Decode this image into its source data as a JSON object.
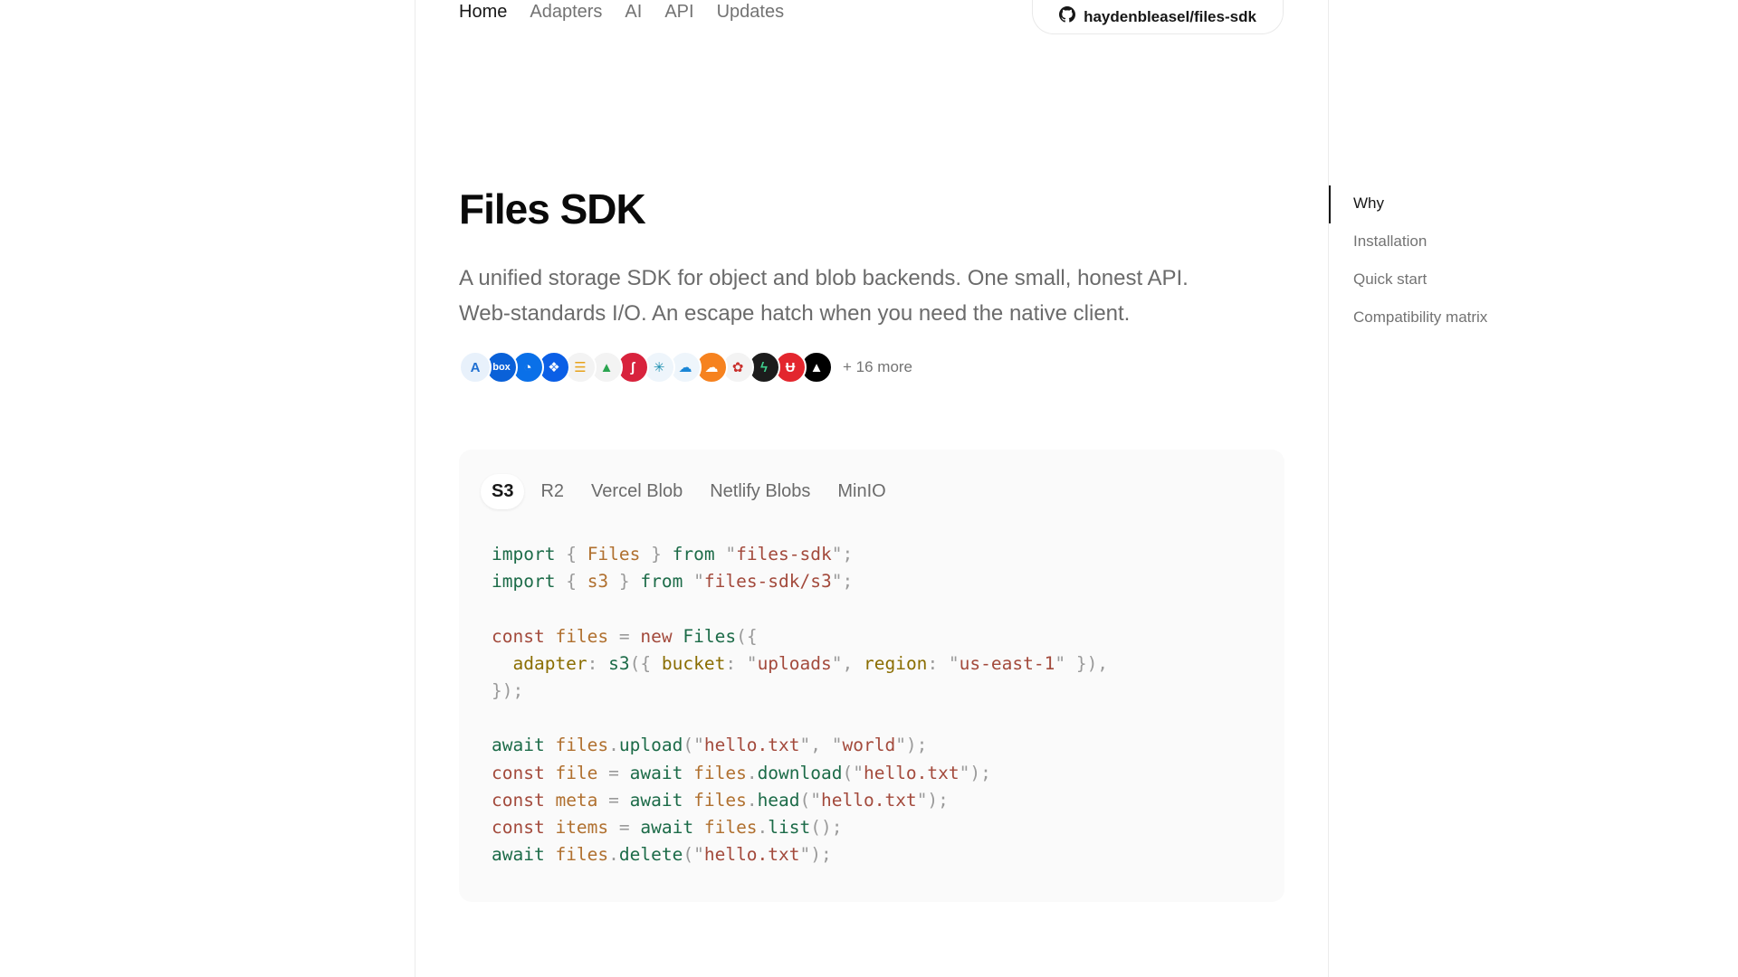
{
  "nav": {
    "links": [
      "Home",
      "Adapters",
      "AI",
      "API",
      "Updates"
    ],
    "repo_label": "haydenbleasel/files-sdk"
  },
  "hero": {
    "title": "Files SDK",
    "subtitle": "A unified storage SDK for object and blob backends. One small, honest API. Web-standards I/O. An escape hatch when you need the native client."
  },
  "adapters": {
    "icons": [
      {
        "name": "azure-icon",
        "glyph": "A",
        "bg": "#e8f1fb",
        "fg": "#1f6fd1"
      },
      {
        "name": "box-icon",
        "glyph": "box",
        "bg": "#0a61d8",
        "fg": "#ffffff"
      },
      {
        "name": "digitalocean-icon",
        "glyph": "◔",
        "bg": "#0a70e8",
        "fg": "#ffffff"
      },
      {
        "name": "dropbox-icon",
        "glyph": "❖",
        "bg": "#0b5fe6",
        "fg": "#ffffff"
      },
      {
        "name": "firebase-icon",
        "glyph": "☰",
        "bg": "#f3f3f3",
        "fg": "#e7a21a"
      },
      {
        "name": "google-drive-icon",
        "glyph": "▲",
        "bg": "#f3f3f3",
        "fg": "#2aa44f"
      },
      {
        "name": "hetzner-icon",
        "glyph": "ʃ",
        "bg": "#d8233d",
        "fg": "#ffffff"
      },
      {
        "name": "imagekit-icon",
        "glyph": "✳",
        "bg": "#eef5fb",
        "fg": "#1d8fb0"
      },
      {
        "name": "onedrive-icon",
        "glyph": "☁",
        "bg": "#eef5fb",
        "fg": "#1a86d6"
      },
      {
        "name": "cloudflare-icon",
        "glyph": "☁",
        "bg": "#f6821f",
        "fg": "#ffffff"
      },
      {
        "name": "huawei-icon",
        "glyph": "✿",
        "bg": "#f3f3f3",
        "fg": "#c9302c"
      },
      {
        "name": "supabase-icon",
        "glyph": "ϟ",
        "bg": "#1c1c1c",
        "fg": "#3ecf8e"
      },
      {
        "name": "uploadthing-icon",
        "glyph": "Ʉ",
        "bg": "#e3262e",
        "fg": "#ffffff"
      },
      {
        "name": "vercel-icon",
        "glyph": "▲",
        "bg": "#000000",
        "fg": "#ffffff"
      }
    ],
    "more_label": "+ 16 more"
  },
  "code": {
    "tabs": [
      "S3",
      "R2",
      "Vercel Blob",
      "Netlify Blobs",
      "MinIO"
    ],
    "active_tab": "S3",
    "lines": [
      [
        [
          "kw",
          "import"
        ],
        [
          "pun",
          " { "
        ],
        [
          "id",
          "Files"
        ],
        [
          "pun",
          " } "
        ],
        [
          "kw",
          "from"
        ],
        [
          "pun",
          " \""
        ],
        [
          "str",
          "files-sdk"
        ],
        [
          "pun",
          "\";"
        ]
      ],
      [
        [
          "kw",
          "import"
        ],
        [
          "pun",
          " { "
        ],
        [
          "id",
          "s3"
        ],
        [
          "pun",
          " } "
        ],
        [
          "kw",
          "from"
        ],
        [
          "pun",
          " \""
        ],
        [
          "str",
          "files-sdk/s3"
        ],
        [
          "pun",
          "\";"
        ]
      ],
      [],
      [
        [
          "kw2",
          "const"
        ],
        [
          "pun",
          " "
        ],
        [
          "id",
          "files"
        ],
        [
          "pun",
          " = "
        ],
        [
          "kw2",
          "new"
        ],
        [
          "pun",
          " "
        ],
        [
          "fn",
          "Files"
        ],
        [
          "pun",
          "({"
        ]
      ],
      [
        [
          "pun",
          "  "
        ],
        [
          "prop",
          "adapter"
        ],
        [
          "pun",
          ": "
        ],
        [
          "fn",
          "s3"
        ],
        [
          "pun",
          "({ "
        ],
        [
          "prop",
          "bucket"
        ],
        [
          "pun",
          ": \""
        ],
        [
          "str",
          "uploads"
        ],
        [
          "pun",
          "\", "
        ],
        [
          "prop",
          "region"
        ],
        [
          "pun",
          ": \""
        ],
        [
          "str",
          "us-east-1"
        ],
        [
          "pun",
          "\" }),"
        ]
      ],
      [
        [
          "pun",
          "});"
        ]
      ],
      [],
      [
        [
          "kw",
          "await"
        ],
        [
          "pun",
          " "
        ],
        [
          "id",
          "files"
        ],
        [
          "pun",
          "."
        ],
        [
          "fn",
          "upload"
        ],
        [
          "pun",
          "(\""
        ],
        [
          "str",
          "hello.txt"
        ],
        [
          "pun",
          "\", \""
        ],
        [
          "str",
          "world"
        ],
        [
          "pun",
          "\");"
        ]
      ],
      [
        [
          "kw2",
          "const"
        ],
        [
          "pun",
          " "
        ],
        [
          "id",
          "file"
        ],
        [
          "pun",
          " = "
        ],
        [
          "kw",
          "await"
        ],
        [
          "pun",
          " "
        ],
        [
          "id",
          "files"
        ],
        [
          "pun",
          "."
        ],
        [
          "fn",
          "download"
        ],
        [
          "pun",
          "(\""
        ],
        [
          "str",
          "hello.txt"
        ],
        [
          "pun",
          "\");"
        ]
      ],
      [
        [
          "kw2",
          "const"
        ],
        [
          "pun",
          " "
        ],
        [
          "id",
          "meta"
        ],
        [
          "pun",
          " = "
        ],
        [
          "kw",
          "await"
        ],
        [
          "pun",
          " "
        ],
        [
          "id",
          "files"
        ],
        [
          "pun",
          "."
        ],
        [
          "fn",
          "head"
        ],
        [
          "pun",
          "(\""
        ],
        [
          "str",
          "hello.txt"
        ],
        [
          "pun",
          "\");"
        ]
      ],
      [
        [
          "kw2",
          "const"
        ],
        [
          "pun",
          " "
        ],
        [
          "id",
          "items"
        ],
        [
          "pun",
          " = "
        ],
        [
          "kw",
          "await"
        ],
        [
          "pun",
          " "
        ],
        [
          "id",
          "files"
        ],
        [
          "pun",
          "."
        ],
        [
          "fn",
          "list"
        ],
        [
          "pun",
          "();"
        ]
      ],
      [
        [
          "kw",
          "await"
        ],
        [
          "pun",
          " "
        ],
        [
          "id",
          "files"
        ],
        [
          "pun",
          "."
        ],
        [
          "fn",
          "delete"
        ],
        [
          "pun",
          "(\""
        ],
        [
          "str",
          "hello.txt"
        ],
        [
          "pun",
          "\");"
        ]
      ]
    ]
  },
  "toc": {
    "items": [
      "Why",
      "Installation",
      "Quick start",
      "Compatibility matrix"
    ],
    "active": "Why"
  }
}
